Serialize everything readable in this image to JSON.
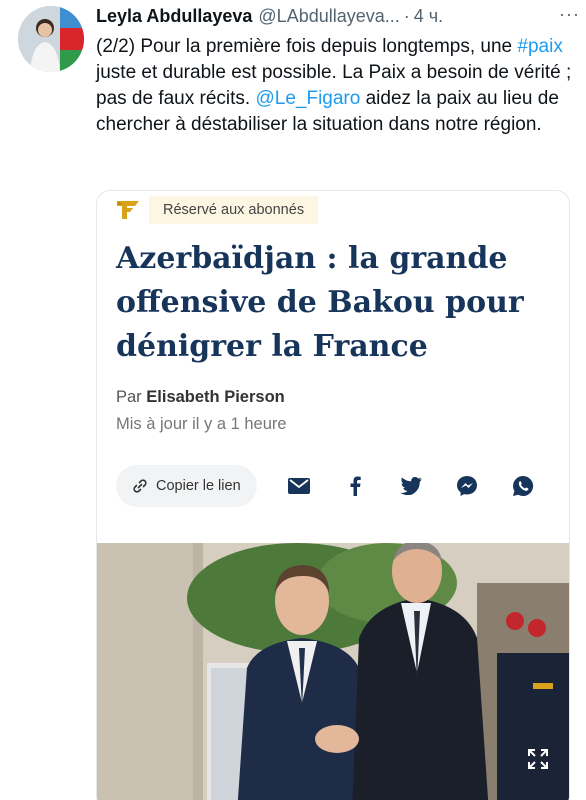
{
  "tweet": {
    "author_name": "Leyla Abdullayeva",
    "author_handle": "@LAbdullayeva...",
    "separator": "·",
    "time": "4 ч.",
    "more": "···",
    "text_prefix": "(2/2) Pour la première fois depuis longtemps, une ",
    "hashtag": "#paix",
    "text_middle": " juste et durable est possible. La Paix a besoin de vérité ; pas de faux récits. ",
    "mention": "@Le_Figaro",
    "text_suffix": " aidez la paix au lieu de chercher à déstabiliser la situation dans notre région."
  },
  "card": {
    "badge": "Réservé aux abonnés",
    "headline": "Azerbaïdjan : la grande offensive de Bakou pour dénigrer la France",
    "byline_prefix": "Par ",
    "author": "Elisabeth Pierson",
    "updated": "Mis à jour il y a 1 heure",
    "copy_link_label": "Copier le lien",
    "share_icons": [
      "envelope-icon",
      "facebook-icon",
      "twitter-icon",
      "messenger-icon",
      "whatsapp-icon"
    ]
  },
  "colors": {
    "link": "#1d9bf0",
    "headline": "#17345a",
    "badge_bg": "#fdf6e3"
  }
}
